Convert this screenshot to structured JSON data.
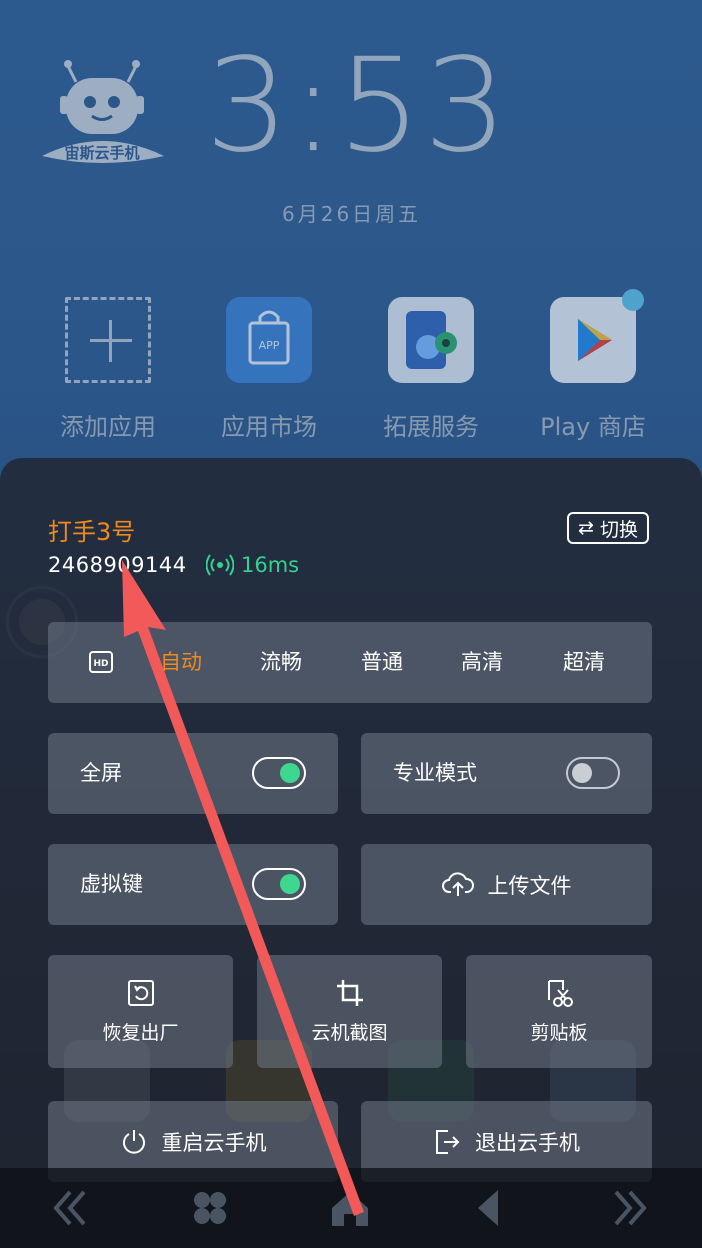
{
  "home": {
    "logo_text": "宙斯云手机",
    "clock": "3:53",
    "date": "6月26日周五",
    "apps": [
      {
        "label": "添加应用",
        "icon": "add-app-icon"
      },
      {
        "label": "应用市场",
        "icon": "app-market-icon",
        "badge_text": "APP"
      },
      {
        "label": "拓展服务",
        "icon": "extension-service-icon"
      },
      {
        "label": "Play 商店",
        "icon": "play-store-icon"
      }
    ]
  },
  "panel": {
    "device_name": "打手3号",
    "device_id": "2468909144",
    "latency": "16ms",
    "switch_label": "切换",
    "quality": {
      "hd_icon_text": "HD",
      "options": [
        "自动",
        "流畅",
        "普通",
        "高清",
        "超清"
      ],
      "selected": "自动"
    },
    "fullscreen": {
      "label": "全屏",
      "on": true
    },
    "pro_mode": {
      "label": "专业模式",
      "on": false
    },
    "virtual_keys": {
      "label": "虚拟键",
      "on": true
    },
    "upload": {
      "label": "上传文件"
    },
    "factory_reset": {
      "label": "恢复出厂"
    },
    "screenshot": {
      "label": "云机截图"
    },
    "clipboard": {
      "label": "剪贴板"
    },
    "reboot": {
      "label": "重启云手机"
    },
    "exit": {
      "label": "退出云手机"
    }
  },
  "colors": {
    "accent_orange": "#f08a1c",
    "toggle_green": "#3fd78f",
    "latency_green": "#35d18e",
    "annotation_red": "#f25a5a"
  }
}
